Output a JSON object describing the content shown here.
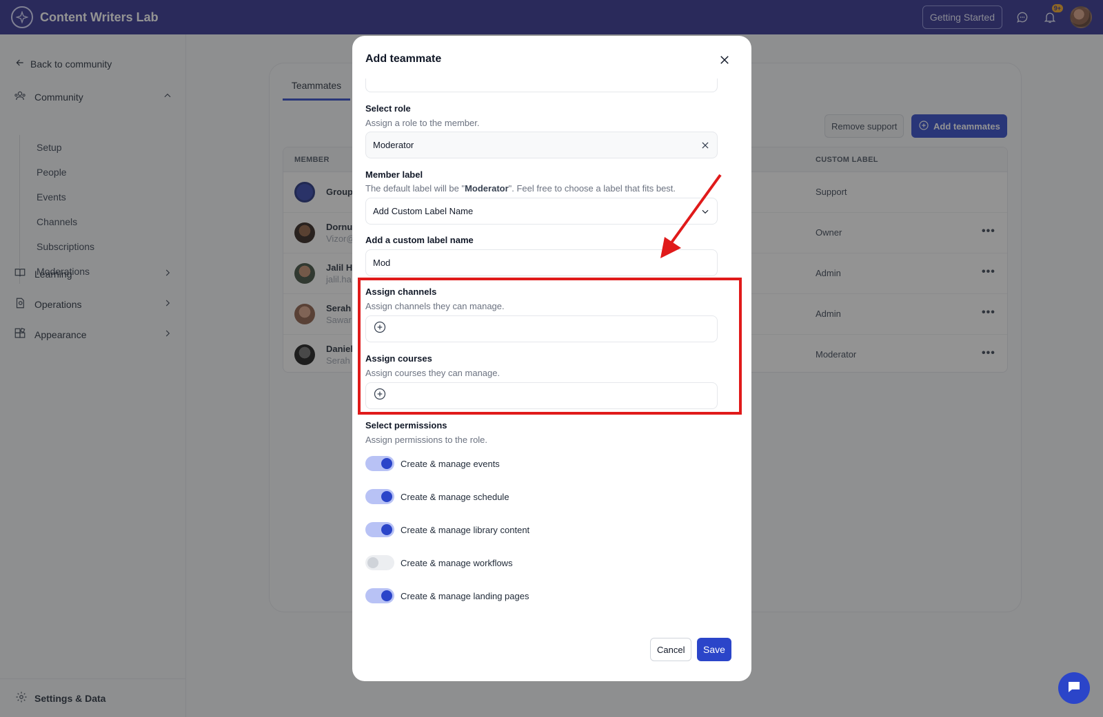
{
  "topbar": {
    "brand": "Content Writers Lab",
    "getting_started": "Getting Started",
    "notification_badge": "9+"
  },
  "sidebar": {
    "back_label": "Back to community",
    "community_label": "Community",
    "community_items": [
      "Setup",
      "People",
      "Events",
      "Channels",
      "Subscriptions",
      "Moderations"
    ],
    "learning_label": "Learning",
    "operations_label": "Operations",
    "appearance_label": "Appearance",
    "settings_label": "Settings & Data"
  },
  "main": {
    "tab_label": "Teammates",
    "remove_support": "Remove support",
    "add_teammates": "Add teammates",
    "columns": {
      "member": "MEMBER",
      "custom_label": "CUSTOM LABEL"
    },
    "rows": [
      {
        "name": "Group",
        "email": "",
        "label": "Support",
        "more": ""
      },
      {
        "name": "Dornu",
        "email": "Vizor@",
        "label": "Owner",
        "more": "•••"
      },
      {
        "name": "Jalil H",
        "email": "jalil.ha",
        "label": "Admin",
        "more": "•••"
      },
      {
        "name": "Serah",
        "email": "Sawar",
        "label": "Admin",
        "more": "•••"
      },
      {
        "name": "Daniel",
        "email": "Serah",
        "label": "Moderator",
        "more": "•••"
      }
    ]
  },
  "modal": {
    "title": "Add teammate",
    "role": {
      "title": "Select role",
      "desc": "Assign a role to the member.",
      "value": "Moderator"
    },
    "member_label": {
      "title": "Member label",
      "desc_before": "The default label will be \"",
      "desc_role": "Moderator",
      "desc_after": "\". Feel free to choose a label that fits best.",
      "value": "Add Custom Label Name"
    },
    "custom_label": {
      "title": "Add a custom label name",
      "value": "Mod"
    },
    "channels": {
      "title": "Assign channels",
      "desc": "Assign channels they can manage."
    },
    "courses": {
      "title": "Assign courses",
      "desc": "Assign courses they can manage."
    },
    "permissions": {
      "title": "Select permissions",
      "desc": "Assign permissions to the role.",
      "items": [
        {
          "label": "Create & manage events",
          "enabled": true
        },
        {
          "label": "Create & manage schedule",
          "enabled": true
        },
        {
          "label": "Create & manage library content",
          "enabled": true
        },
        {
          "label": "Create & manage workflows",
          "enabled": false
        },
        {
          "label": "Create & manage landing pages",
          "enabled": true
        }
      ]
    },
    "cancel": "Cancel",
    "save": "Save"
  },
  "colors": {
    "topbar": "#2d2c8f",
    "accent": "#2b45c9",
    "highlight": "#e01a1a"
  }
}
